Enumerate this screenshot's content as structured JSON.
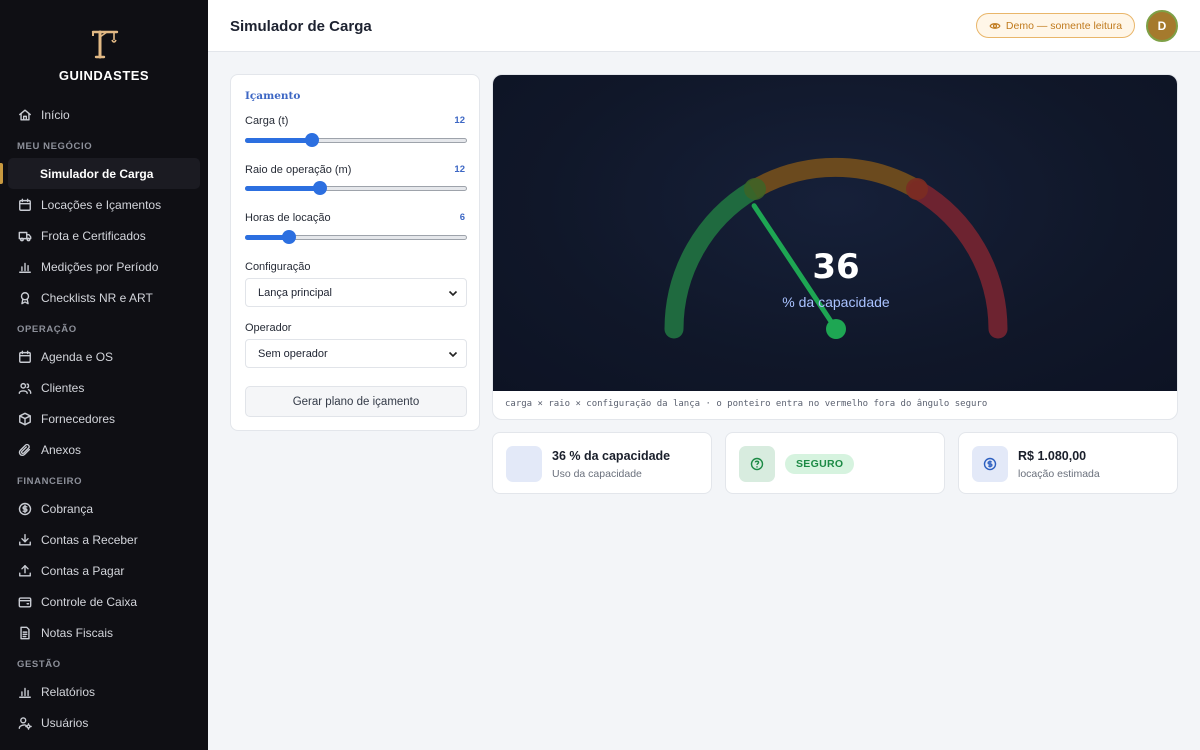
{
  "brand": {
    "name": "GUINDASTES"
  },
  "sidebar": {
    "home": {
      "label": "Início",
      "icon": "home-icon"
    },
    "sections": [
      {
        "title": "MEU NEGÓCIO",
        "items": [
          {
            "label": "Simulador de Carga",
            "icon": "",
            "active": true
          },
          {
            "label": "Locações e Içamentos",
            "icon": "calendar-icon"
          },
          {
            "label": "Frota e Certificados",
            "icon": "truck-icon"
          },
          {
            "label": "Medições por Período",
            "icon": "bar-chart-icon"
          },
          {
            "label": "Checklists NR e ART",
            "icon": "award-icon"
          }
        ]
      },
      {
        "title": "OPERAÇÃO",
        "items": [
          {
            "label": "Agenda e OS",
            "icon": "calendar-icon"
          },
          {
            "label": "Clientes",
            "icon": "users-icon"
          },
          {
            "label": "Fornecedores",
            "icon": "box-icon"
          },
          {
            "label": "Anexos",
            "icon": "paperclip-icon"
          }
        ]
      },
      {
        "title": "FINANCEIRO",
        "items": [
          {
            "label": "Cobrança",
            "icon": "dollar-circle-icon"
          },
          {
            "label": "Contas a Receber",
            "icon": "download-icon"
          },
          {
            "label": "Contas a Pagar",
            "icon": "upload-icon"
          },
          {
            "label": "Controle de Caixa",
            "icon": "wallet-icon"
          },
          {
            "label": "Notas Fiscais",
            "icon": "file-icon"
          }
        ]
      },
      {
        "title": "GESTÃO",
        "items": [
          {
            "label": "Relatórios",
            "icon": "bar-chart-icon"
          },
          {
            "label": "Usuários",
            "icon": "user-cog-icon"
          }
        ]
      }
    ]
  },
  "header": {
    "title": "Simulador de Carga",
    "demo_badge": "Demo — somente leitura",
    "avatar_initial": "D"
  },
  "controls": {
    "section_title": "Içamento",
    "load": {
      "label": "Carga (t)",
      "value": "12",
      "fraction": 0.3
    },
    "radius": {
      "label": "Raio de operação (m)",
      "value": "12",
      "fraction": 0.34
    },
    "hours": {
      "label": "Horas de locação",
      "value": "6",
      "fraction": 0.2
    },
    "configuration": {
      "label": "Configuração",
      "selected": "Lança principal"
    },
    "operator": {
      "label": "Operador",
      "selected": "Sem operador"
    },
    "plan_button": "Gerar plano de içamento"
  },
  "gauge": {
    "value": "36",
    "value_number": 36,
    "label": "% da capacidade",
    "note": "carga × raio × configuração da lança · o ponteiro entra no vermelho fora do ângulo seguro",
    "colors": {
      "safe": "#1f6a3f",
      "warn": "#6b4a1e",
      "danger": "#6d2330",
      "needle": "#1ea653"
    }
  },
  "stats": {
    "capacity": {
      "value": "36 % da capacidade",
      "label": "Uso da capacidade"
    },
    "status": {
      "badge": "SEGURO"
    },
    "rent": {
      "value": "R$ 1.080,00",
      "label": "locação estimada"
    }
  }
}
